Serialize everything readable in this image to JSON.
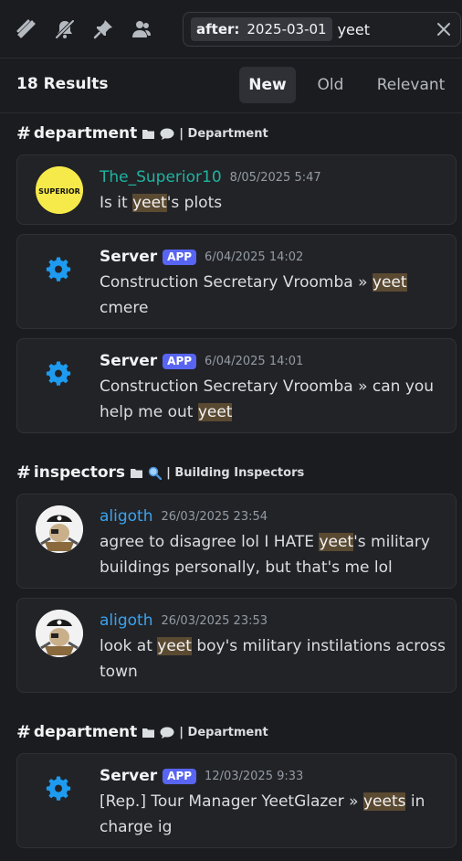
{
  "toolbar": {
    "icons": [
      "threads-icon",
      "mute-icon",
      "pin-icon",
      "members-icon"
    ],
    "search": {
      "filter_key": "after:",
      "filter_value": "2025-03-01",
      "query": "yeet"
    }
  },
  "results": {
    "count_label": "18 Results",
    "sort_tabs": [
      {
        "label": "New",
        "active": true
      },
      {
        "label": "Old",
        "active": false
      },
      {
        "label": "Relevant",
        "active": false
      }
    ]
  },
  "groups": [
    {
      "channel": "department",
      "sub_label": "| Department",
      "sub_icon": "speech-bubble-icon",
      "messages": [
        {
          "author": "The_Superior10",
          "avatar": "superior-logo",
          "avatar_text": "SUPERIOR",
          "time": "8/05/2025 5:47",
          "body": [
            "Is it ",
            {
              "hl": "yeet"
            },
            "'s plots"
          ]
        },
        {
          "author": "Server",
          "badge": "APP",
          "time": "6/04/2025 14:02",
          "body": [
            "Construction Secretary Vroomba » ",
            {
              "hl": "yeet"
            },
            " cmere"
          ]
        },
        {
          "author": "Server",
          "badge": "APP",
          "time": "6/04/2025 14:01",
          "body": [
            "Construction Secretary Vroomba » can you help me out ",
            {
              "hl": "yeet"
            }
          ]
        }
      ]
    },
    {
      "channel": "inspectors",
      "sub_label": "| Building Inspectors",
      "sub_icon": "magnifier-icon",
      "messages": [
        {
          "author": "aligoth",
          "avatar": "pirate-avatar",
          "time": "26/03/2025 23:54",
          "body": [
            "agree to disagree lol I HATE ",
            {
              "hl": "yeet"
            },
            "'s military buildings personally, but that's me lol"
          ]
        },
        {
          "author": "aligoth",
          "avatar": "pirate-avatar",
          "time": "26/03/2025 23:53",
          "body": [
            "look at ",
            {
              "hl": "yeet"
            },
            " boy's military instilations across town"
          ]
        }
      ]
    },
    {
      "channel": "department",
      "sub_label": "| Department",
      "sub_icon": "speech-bubble-icon",
      "messages": [
        {
          "author": "Server",
          "badge": "APP",
          "time": "12/03/2025 9:33",
          "body": [
            "[Rep.] Tour Manager YeetGlazer » ",
            {
              "hl": "yeets"
            },
            " in charge ig"
          ]
        }
      ]
    }
  ],
  "colors": {
    "background": "#1b1c1f",
    "card": "#222327",
    "highlight": "#5b4a32",
    "app_badge": "#5865f2",
    "gear": "#1e9bf0",
    "author_teal": "#1fb3a1",
    "author_blue": "#3aa3f0"
  }
}
